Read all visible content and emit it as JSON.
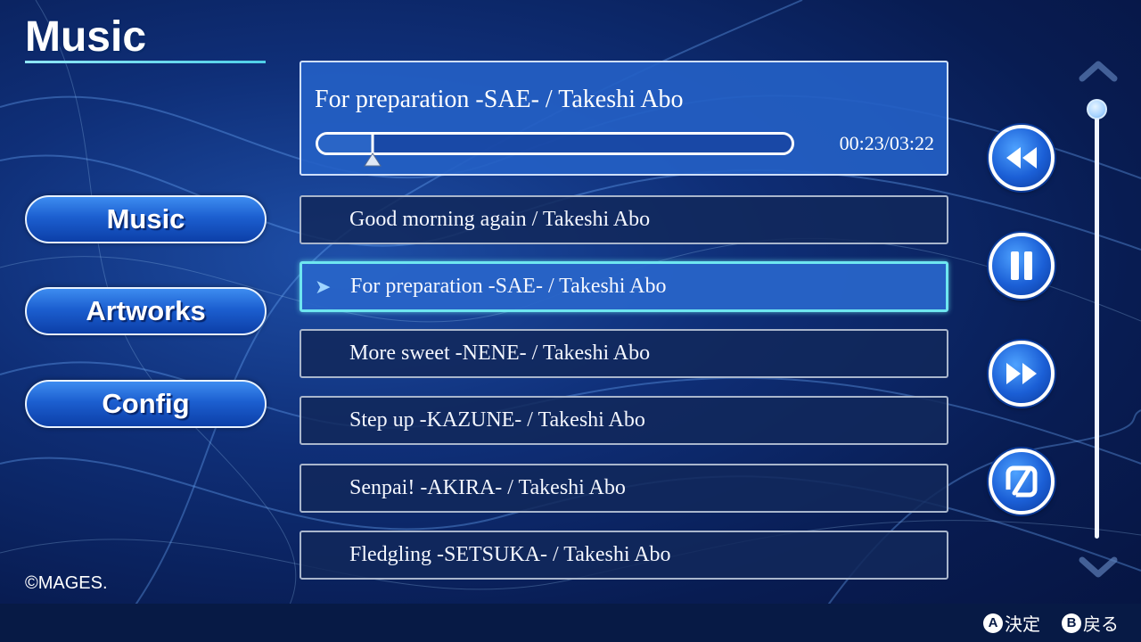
{
  "header": {
    "title": "Music"
  },
  "nav": {
    "items": [
      {
        "label": "Music"
      },
      {
        "label": "Artworks"
      },
      {
        "label": "Config"
      }
    ]
  },
  "now_playing": {
    "title": "For preparation -SAE- / Takeshi Abo",
    "elapsed": "00:23",
    "separator": "/",
    "duration": "03:22",
    "progress_fraction": 0.114
  },
  "tracks": [
    {
      "label": "Good morning again / Takeshi Abo",
      "selected": false
    },
    {
      "label": "For preparation -SAE- / Takeshi Abo",
      "selected": true
    },
    {
      "label": "More sweet -NENE- / Takeshi Abo",
      "selected": false
    },
    {
      "label": "Step up -KAZUNE- / Takeshi Abo",
      "selected": false
    },
    {
      "label": "Senpai! -AKIRA- / Takeshi Abo",
      "selected": false
    },
    {
      "label": "Fledgling -SETSUKA- / Takeshi Abo",
      "selected": false
    }
  ],
  "selected_marker": "➤",
  "controls": {
    "icons": [
      "rewind-icon",
      "pause-icon",
      "fast-forward-icon",
      "loop-toggle-icon"
    ]
  },
  "scroll": {
    "position_fraction": 0.0
  },
  "footer": {
    "copyright": "©MAGES.",
    "hints": [
      {
        "key": "A",
        "label": "決定"
      },
      {
        "key": "B",
        "label": "戻る"
      }
    ]
  },
  "colors": {
    "accent_cyan": "#6ee6f0",
    "panel_blue": "#2460c4",
    "button_blue": "#1c5fd0",
    "bottom_bar": "#071a45"
  }
}
